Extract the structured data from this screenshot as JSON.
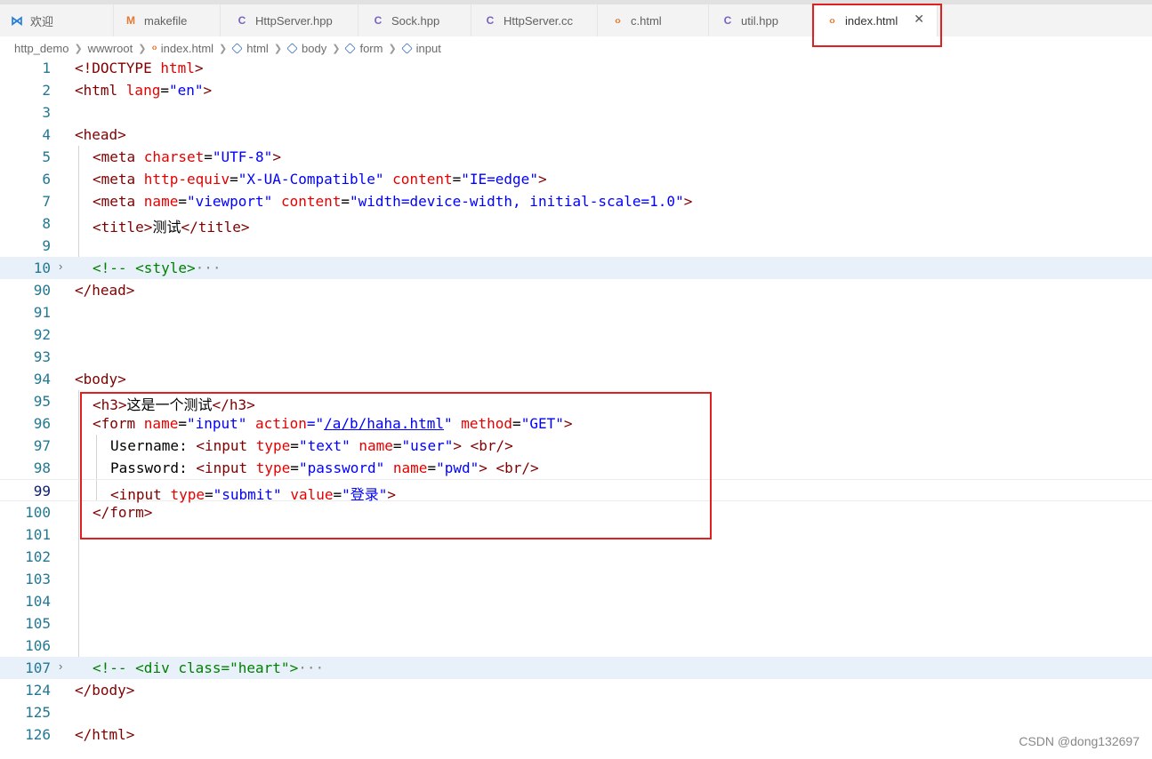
{
  "tabs": [
    {
      "label": "欢迎",
      "icon": "vscode-icon"
    },
    {
      "label": "makefile",
      "icon": "makefile-m-icon"
    },
    {
      "label": "HttpServer.hpp",
      "icon": "cpp-icon"
    },
    {
      "label": "Sock.hpp",
      "icon": "cpp-icon"
    },
    {
      "label": "HttpServer.cc",
      "icon": "cpp-icon"
    },
    {
      "label": "c.html",
      "icon": "html-icon"
    },
    {
      "label": "util.hpp",
      "icon": "cpp-icon"
    },
    {
      "label": "index.html",
      "icon": "html-icon",
      "active": true
    }
  ],
  "breadcrumb": [
    "http_demo",
    "wwwroot",
    "index.html",
    "html",
    "body",
    "form",
    "input"
  ],
  "line_numbers": [
    "1",
    "2",
    "3",
    "4",
    "5",
    "6",
    "7",
    "8",
    "9",
    "10",
    "90",
    "91",
    "92",
    "93",
    "94",
    "95",
    "96",
    "97",
    "98",
    "99",
    "100",
    "101",
    "102",
    "103",
    "104",
    "105",
    "106",
    "107",
    "124",
    "125",
    "126"
  ],
  "code": {
    "l1": [
      "<!DOCTYPE ",
      "html",
      ">"
    ],
    "l2": [
      "<html ",
      "lang",
      "=",
      "\"en\"",
      ">"
    ],
    "l4": "<head>",
    "l5": [
      "<meta ",
      "charset",
      "=",
      "\"UTF-8\"",
      ">"
    ],
    "l6": [
      "<meta ",
      "http-equiv",
      "=",
      "\"X-UA-Compatible\"",
      " ",
      "content",
      "=",
      "\"IE=edge\"",
      ">"
    ],
    "l7": [
      "<meta ",
      "name",
      "=",
      "\"viewport\"",
      " ",
      "content",
      "=",
      "\"width=device-width, initial-scale=1.0\"",
      ">"
    ],
    "l8": [
      "<title>",
      "测试",
      "</title>"
    ],
    "l10": [
      "<!-- ",
      "<style>",
      "···"
    ],
    "l90": "</head>",
    "l94": "<body>",
    "l95": [
      "<h3>",
      "这是一个测试",
      "</h3>"
    ],
    "l96": [
      "<form ",
      "name",
      "=",
      "\"input\"",
      " ",
      "action",
      "=\"",
      "/a/b/haha.html",
      "\"",
      " ",
      "method",
      "=",
      "\"GET\"",
      ">"
    ],
    "l97": [
      "Username: ",
      "<input ",
      "type",
      "=",
      "\"text\"",
      " ",
      "name",
      "=",
      "\"user\"",
      "> ",
      "<br/>"
    ],
    "l98": [
      "Password: ",
      "<input ",
      "type",
      "=",
      "\"password\"",
      " ",
      "name",
      "=",
      "\"pwd\"",
      "> ",
      "<br/>"
    ],
    "l99": [
      "<input ",
      "type",
      "=",
      "\"submit\"",
      " ",
      "value",
      "=",
      "\"登录\"",
      ">"
    ],
    "l100": "</form>",
    "l107": [
      "<!-- ",
      "<div class=\"heart\">",
      "···"
    ],
    "l124": "</body>",
    "l126": "</html>"
  },
  "close_glyph": "✕",
  "fold_glyph": "›",
  "watermark": "CSDN @dong132697",
  "colors": {
    "tag": "#800000",
    "attribute": "#e50000",
    "value": "#0000ff",
    "comment": "#008000",
    "line_number": "#237893",
    "highlight_box": "#e02020"
  }
}
